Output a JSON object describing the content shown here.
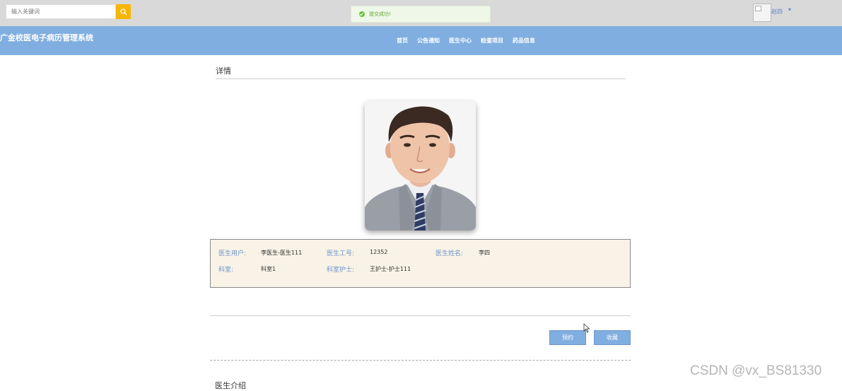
{
  "search": {
    "placeholder": "输入关键词"
  },
  "toast": {
    "message": "提交成功!"
  },
  "user": {
    "name": "赵四",
    "caret": "▾"
  },
  "header": {
    "site_title": "广金校医电子病历管理系统",
    "nav": [
      "首页",
      "公告通知",
      "医生中心",
      "检查项目",
      "药品信息"
    ]
  },
  "detail": {
    "title": "详情",
    "fields": {
      "doctor_account_label": "医生用户:",
      "doctor_account_value": "李医生-医生111",
      "doctor_id_label": "医生工号:",
      "doctor_id_value": "12352",
      "doctor_name_label": "医生姓名:",
      "doctor_name_value": "李四",
      "department_label": "科室:",
      "department_value": "科室1",
      "nurse_label": "科室护士:",
      "nurse_value": "王护士-护士111"
    },
    "actions": {
      "book": "预约",
      "favorite": "收藏"
    },
    "intro_title": "医生介绍"
  },
  "watermark": "CSDN @vx_BS81330",
  "colors": {
    "nav": "#80aee0",
    "label": "#6d95cc",
    "panel": "#f8f3e6",
    "search_button": "#f7b500"
  }
}
